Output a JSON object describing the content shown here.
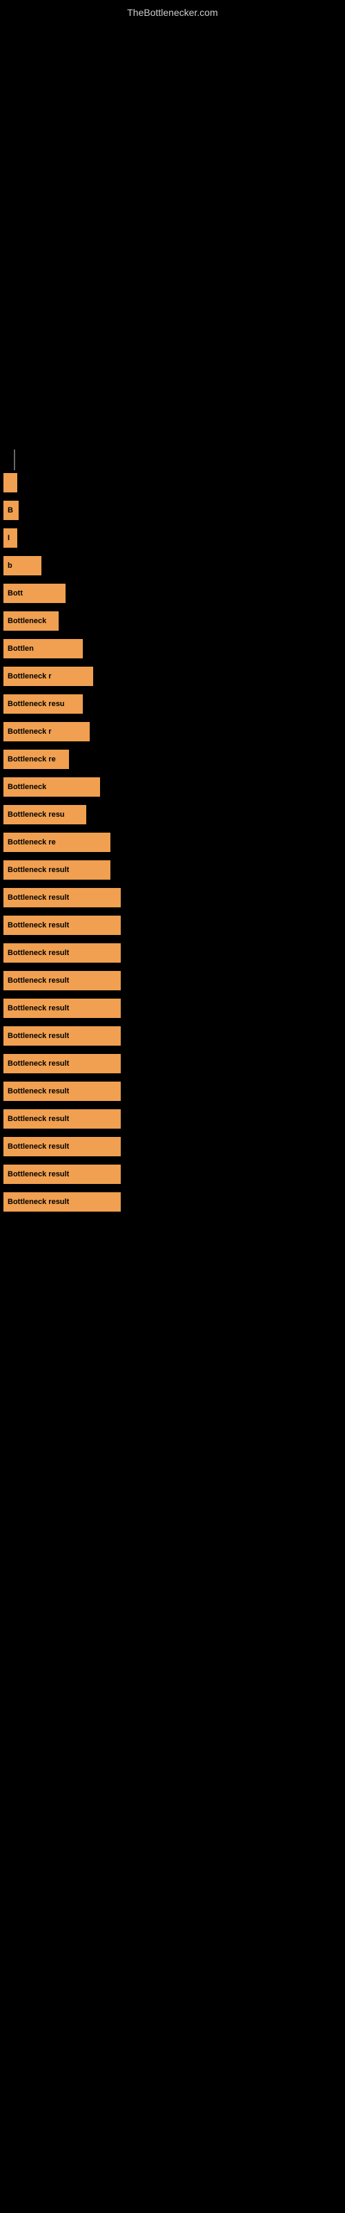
{
  "site": {
    "title": "TheBottlenecker.com"
  },
  "bars": [
    {
      "id": 1,
      "label": "",
      "width_class": "bar-1"
    },
    {
      "id": 2,
      "label": "B",
      "width_class": "bar-2"
    },
    {
      "id": 3,
      "label": "I",
      "width_class": "bar-3"
    },
    {
      "id": 4,
      "label": "b",
      "width_class": "bar-4"
    },
    {
      "id": 5,
      "label": "Bott",
      "width_class": "bar-5"
    },
    {
      "id": 6,
      "label": "Bottleneck",
      "width_class": "bar-6"
    },
    {
      "id": 7,
      "label": "Bottlen",
      "width_class": "bar-7"
    },
    {
      "id": 8,
      "label": "Bottleneck r",
      "width_class": "bar-8"
    },
    {
      "id": 9,
      "label": "Bottleneck resu",
      "width_class": "bar-9"
    },
    {
      "id": 10,
      "label": "Bottleneck r",
      "width_class": "bar-10"
    },
    {
      "id": 11,
      "label": "Bottleneck re",
      "width_class": "bar-11"
    },
    {
      "id": 12,
      "label": "Bottleneck",
      "width_class": "bar-12"
    },
    {
      "id": 13,
      "label": "Bottleneck resu",
      "width_class": "bar-13"
    },
    {
      "id": 14,
      "label": "Bottleneck re",
      "width_class": "bar-14"
    },
    {
      "id": 15,
      "label": "Bottleneck result",
      "width_class": "bar-15"
    },
    {
      "id": 16,
      "label": "Bottleneck result",
      "width_class": "bar-16"
    },
    {
      "id": 17,
      "label": "Bottleneck result",
      "width_class": "bar-17"
    },
    {
      "id": 18,
      "label": "Bottleneck result",
      "width_class": "bar-18"
    },
    {
      "id": 19,
      "label": "Bottleneck result",
      "width_class": "bar-19"
    },
    {
      "id": 20,
      "label": "Bottleneck result",
      "width_class": "bar-20"
    },
    {
      "id": 21,
      "label": "Bottleneck result",
      "width_class": "bar-21"
    },
    {
      "id": 22,
      "label": "Bottleneck result",
      "width_class": "bar-22"
    },
    {
      "id": 23,
      "label": "Bottleneck result",
      "width_class": "bar-23"
    },
    {
      "id": 24,
      "label": "Bottleneck result",
      "width_class": "bar-24"
    },
    {
      "id": 25,
      "label": "Bottleneck result",
      "width_class": "bar-25"
    },
    {
      "id": 26,
      "label": "Bottleneck result",
      "width_class": "bar-26"
    },
    {
      "id": 27,
      "label": "Bottleneck result",
      "width_class": "bar-27"
    }
  ]
}
